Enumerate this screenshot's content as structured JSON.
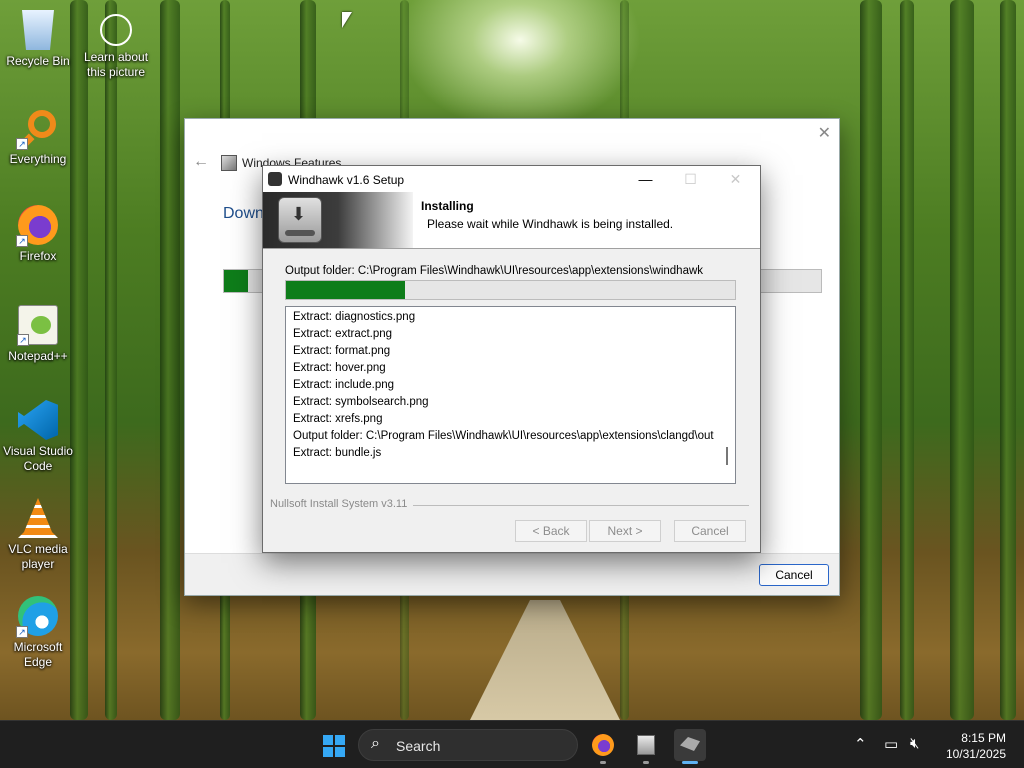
{
  "desktop": {
    "icons": [
      {
        "label": "Recycle Bin"
      },
      {
        "label": "Learn about this picture"
      },
      {
        "label": "Everything"
      },
      {
        "label": "Firefox"
      },
      {
        "label": "Notepad++"
      },
      {
        "label": "Visual Studio Code"
      },
      {
        "label": "VLC media player"
      },
      {
        "label": "Microsoft Edge"
      }
    ]
  },
  "features_window": {
    "title": "Windows Features",
    "heading": "Down",
    "progress_fraction": 0.04,
    "cancel_label": "Cancel"
  },
  "setup": {
    "title": "Windhawk v1.6 Setup",
    "header_title": "Installing",
    "header_subtitle": "Please wait while Windhawk is being installed.",
    "output_folder": "Output folder: C:\\Program Files\\Windhawk\\UI\\resources\\app\\extensions\\windhawk",
    "progress_fraction": 0.265,
    "log": [
      "Extract: diagnostics.png",
      "Extract: extract.png",
      "Extract: format.png",
      "Extract: hover.png",
      "Extract: include.png",
      "Extract: symbolsearch.png",
      "Extract: xrefs.png",
      "Output folder: C:\\Program Files\\Windhawk\\UI\\resources\\app\\extensions\\clangd\\out",
      "Extract: bundle.js"
    ],
    "footer": "Nullsoft Install System v3.11",
    "back_label": "< Back",
    "next_label": "Next >",
    "cancel_label": "Cancel"
  },
  "taskbar": {
    "search_label": "Search",
    "time": "8:15 PM",
    "date": "10/31/2025"
  },
  "colors": {
    "progress_green": "#0e7d1a",
    "accent_blue": "#2a66c9"
  }
}
